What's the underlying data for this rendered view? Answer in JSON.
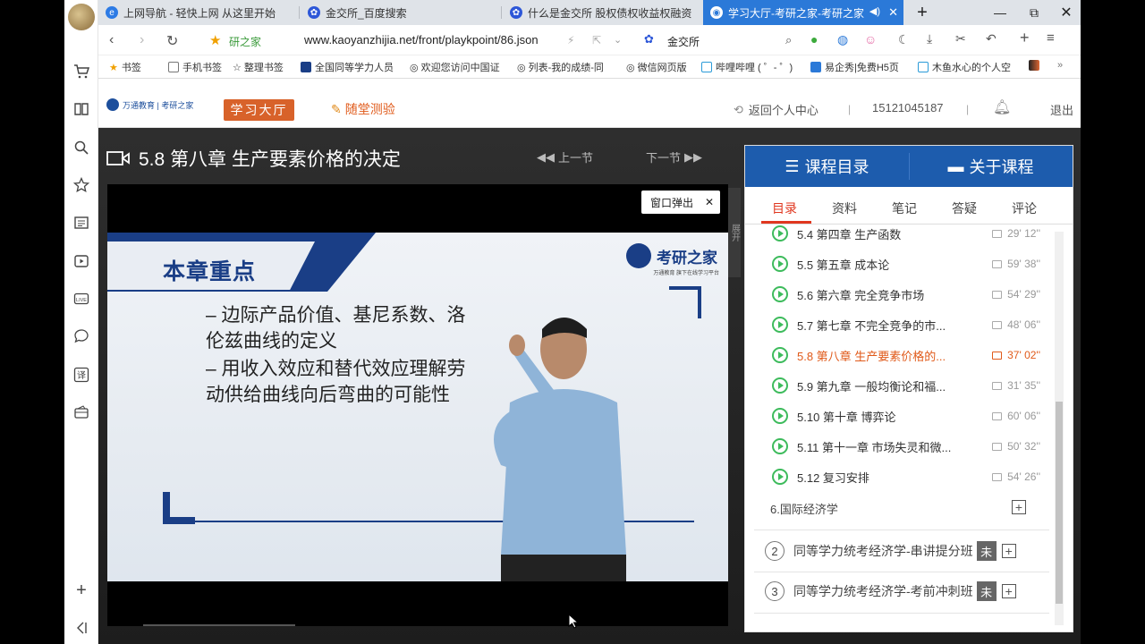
{
  "tabs": [
    {
      "label": "上网导航 - 轻快上网 从这里开始"
    },
    {
      "label": "金交所_百度搜索"
    },
    {
      "label": "什么是金交所 股权债权收益权融资"
    },
    {
      "label": "学习大厅-考研之家-考研之家"
    }
  ],
  "address": {
    "site_tag": "研之家",
    "url": "www.kaoyanzhijia.net/front/playkpoint/86.json",
    "search_engine": "金交所"
  },
  "bookmarks": [
    "书签",
    "手机书签",
    "整理书签",
    "全国同等学力人员",
    "欢迎您访问中国证",
    "列表-我的成绩-同",
    "微信网页版",
    "哔哩哔哩 ( ゜- ゜)",
    "易企秀|免费H5页",
    "木鱼水心的个人空"
  ],
  "site": {
    "logo_text": "万通教育 | 考研之家",
    "nav_study": "学习大厅",
    "nav_test": "随堂测验",
    "back_center": "返回个人中心",
    "phone": "15121045187",
    "logout": "退出"
  },
  "player": {
    "lesson_title": "5.8 第八章 生产要素价格的决定",
    "prev": "上一节",
    "next": "下一节",
    "popup_button": "窗口弹出",
    "expand_label": "展开"
  },
  "slide": {
    "title": "本章重点",
    "bullet1": "– 边际产品价值、基尼系数、洛\n   伦兹曲线的定义",
    "bullet2": "– 用收入效应和替代效应理解劳\n   动供给曲线向后弯曲的可能性",
    "logo": "考研之家",
    "logo_sub": "万通教育 旗下在线学习平台"
  },
  "panel": {
    "tab_catalog": "课程目录",
    "tab_about": "关于课程",
    "subtabs": [
      "目录",
      "资料",
      "笔记",
      "答疑",
      "评论"
    ],
    "items": [
      {
        "title": "5.4 第四章 生产函数",
        "duration": "29' 12''",
        "current": false
      },
      {
        "title": "5.5 第五章 成本论",
        "duration": "59' 38''",
        "current": false
      },
      {
        "title": "5.6 第六章 完全竞争市场",
        "duration": "54' 29''",
        "current": false
      },
      {
        "title": "5.7 第七章 不完全竞争的市...",
        "duration": "48' 06''",
        "current": false
      },
      {
        "title": "5.8 第八章 生产要素价格的...",
        "duration": "37' 02''",
        "current": true
      },
      {
        "title": "5.9 第九章 一般均衡论和福...",
        "duration": "31' 35''",
        "current": false
      },
      {
        "title": "5.10 第十章 博弈论",
        "duration": "60' 06''",
        "current": false
      },
      {
        "title": "5.11 第十一章 市场失灵和微...",
        "duration": "50' 32''",
        "current": false
      },
      {
        "title": "5.12 复习安排",
        "duration": "54' 26''",
        "current": false
      }
    ],
    "section": "6.国际经济学",
    "courses": [
      {
        "num": "2",
        "title": "同等学力统考经济学-串讲提分班",
        "tag": "未"
      },
      {
        "num": "3",
        "title": "同等学力统考经济学-考前冲刺班",
        "tag": "未"
      }
    ]
  },
  "colors": {
    "accent_blue": "#1d5cad",
    "active_red": "#e0371f",
    "play_green": "#3dbb5c",
    "current_orange": "#e05a1a"
  }
}
